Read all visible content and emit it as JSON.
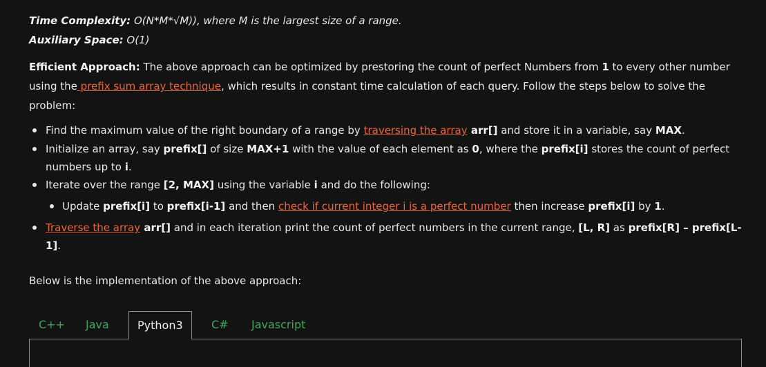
{
  "complexity": {
    "time_label": "Time Complexity:",
    "time_value": " O(N*M*√M)), where M is the largest size of a range.",
    "space_label": "Auxiliary Space:",
    "space_value": " O(1)"
  },
  "approach": {
    "label": "Efficient Approach:",
    "text1": " The above approach can be optimized by prestoring the count of perfect Numbers from ",
    "num1": "1",
    "text2": " to every other number",
    "text3": "using the",
    "link": " prefix sum array technique",
    "text4": ", which results in constant time calculation of each query. Follow the steps below to solve the",
    "text5": "problem:"
  },
  "steps": {
    "s1": {
      "a": "Find the maximum value of the right boundary of a range by ",
      "link": "traversing the array",
      "b": " arr[]",
      "c": " and store it in a variable, say ",
      "d": "MAX",
      "e": "."
    },
    "s2": {
      "a": "Initialize an array, say ",
      "b": "prefix[]",
      "c": " of size ",
      "d": "MAX+1",
      "e": " with the value of each element as ",
      "f": "0",
      "g": ", where the ",
      "h": "prefix[i]",
      "i": " stores the count of perfect",
      "j": "numbers up to ",
      "k": "i",
      "l": "."
    },
    "s3": {
      "a": "Iterate over the range ",
      "b": "[2, MAX]",
      "c": " using the variable ",
      "d": "i",
      "e": " and do the following:"
    },
    "s3a": {
      "a": "Update ",
      "b": "prefix[i]",
      "c": " to ",
      "d": "prefix[i-1]",
      "e": " and then ",
      "link": "check if current integer i is a perfect number",
      "f": " then increase ",
      "g": "prefix[i]",
      "h": " by ",
      "i": "1",
      "j": "."
    },
    "s4": {
      "link": "Traverse the array",
      "a": " arr[]",
      "b": " and in each iteration print the count of perfect numbers in the current range, ",
      "c": "[L, R]",
      "d": " as ",
      "e": "prefix[R] – prefix[L-",
      "f": "1]",
      "g": "."
    }
  },
  "implementation_text": "Below is the implementation of the above approach:",
  "tabs": [
    "C++",
    "Java",
    "Python3",
    "C#",
    "Javascript"
  ],
  "active_tab": "Python3"
}
